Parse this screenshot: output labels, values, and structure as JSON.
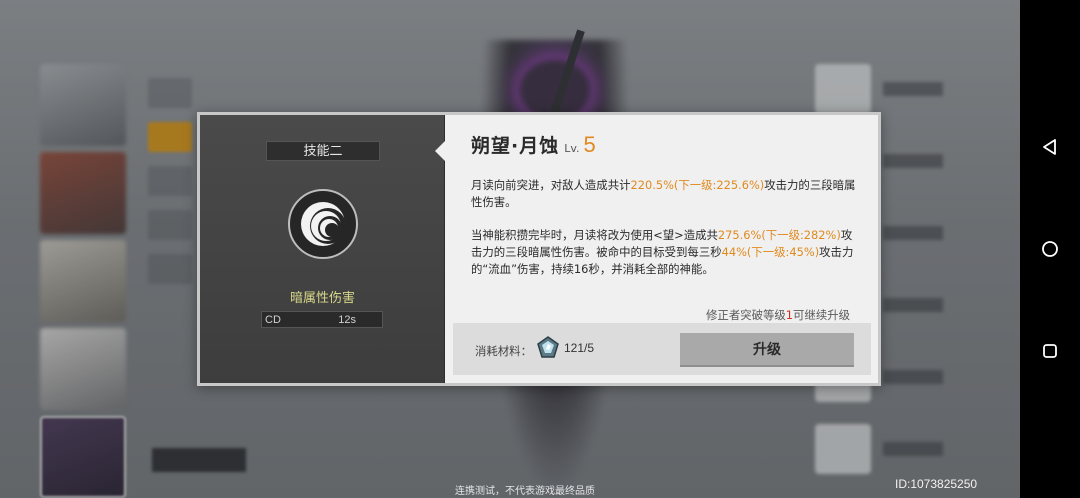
{
  "skill_panel": {
    "slot_label": "技能二",
    "damage_type": "暗属性伤害",
    "cd_label": "CD",
    "cd_value": "12s",
    "icon": "crescent-moon-icon"
  },
  "skill_detail": {
    "name": "朔望·月蚀",
    "level_label": "Lv.",
    "level_value": "5",
    "desc1": {
      "pre": "月读向前突进，对敌人造成共计",
      "highlight": "220.5%(下一级:225.6%)",
      "post": "攻击力的三段暗属性伤害。"
    },
    "desc2": {
      "pre": "当神能积攒完毕时，月读将改为使用<望>造成共",
      "highlight1": "275.6%(下一级:282%)",
      "mid": "攻击力的三段暗属性伤害。被命中的目标受到每三秒",
      "highlight2": "44%(下一级:45%)",
      "post": "攻击力的“流血”伤害，持续16秒，并消耗全部的神能。"
    },
    "upgrade_note": {
      "pre": "修正者突破等级",
      "value": "1",
      "post": "可继续升级"
    }
  },
  "cost": {
    "label": "消耗材料：",
    "item_icon": "crystal-material-icon",
    "count": "121/5",
    "upgrade_button": "升级"
  },
  "footer": {
    "disclaimer": "连携测试，不代表游戏最终品质",
    "uid": "ID:1073825250"
  },
  "navbar": {
    "back": "back-icon",
    "home": "home-icon",
    "recents": "recents-icon"
  },
  "colors": {
    "highlight": "#e08a1e",
    "warning": "#d2321f",
    "damage_type": "#d8d88a"
  }
}
